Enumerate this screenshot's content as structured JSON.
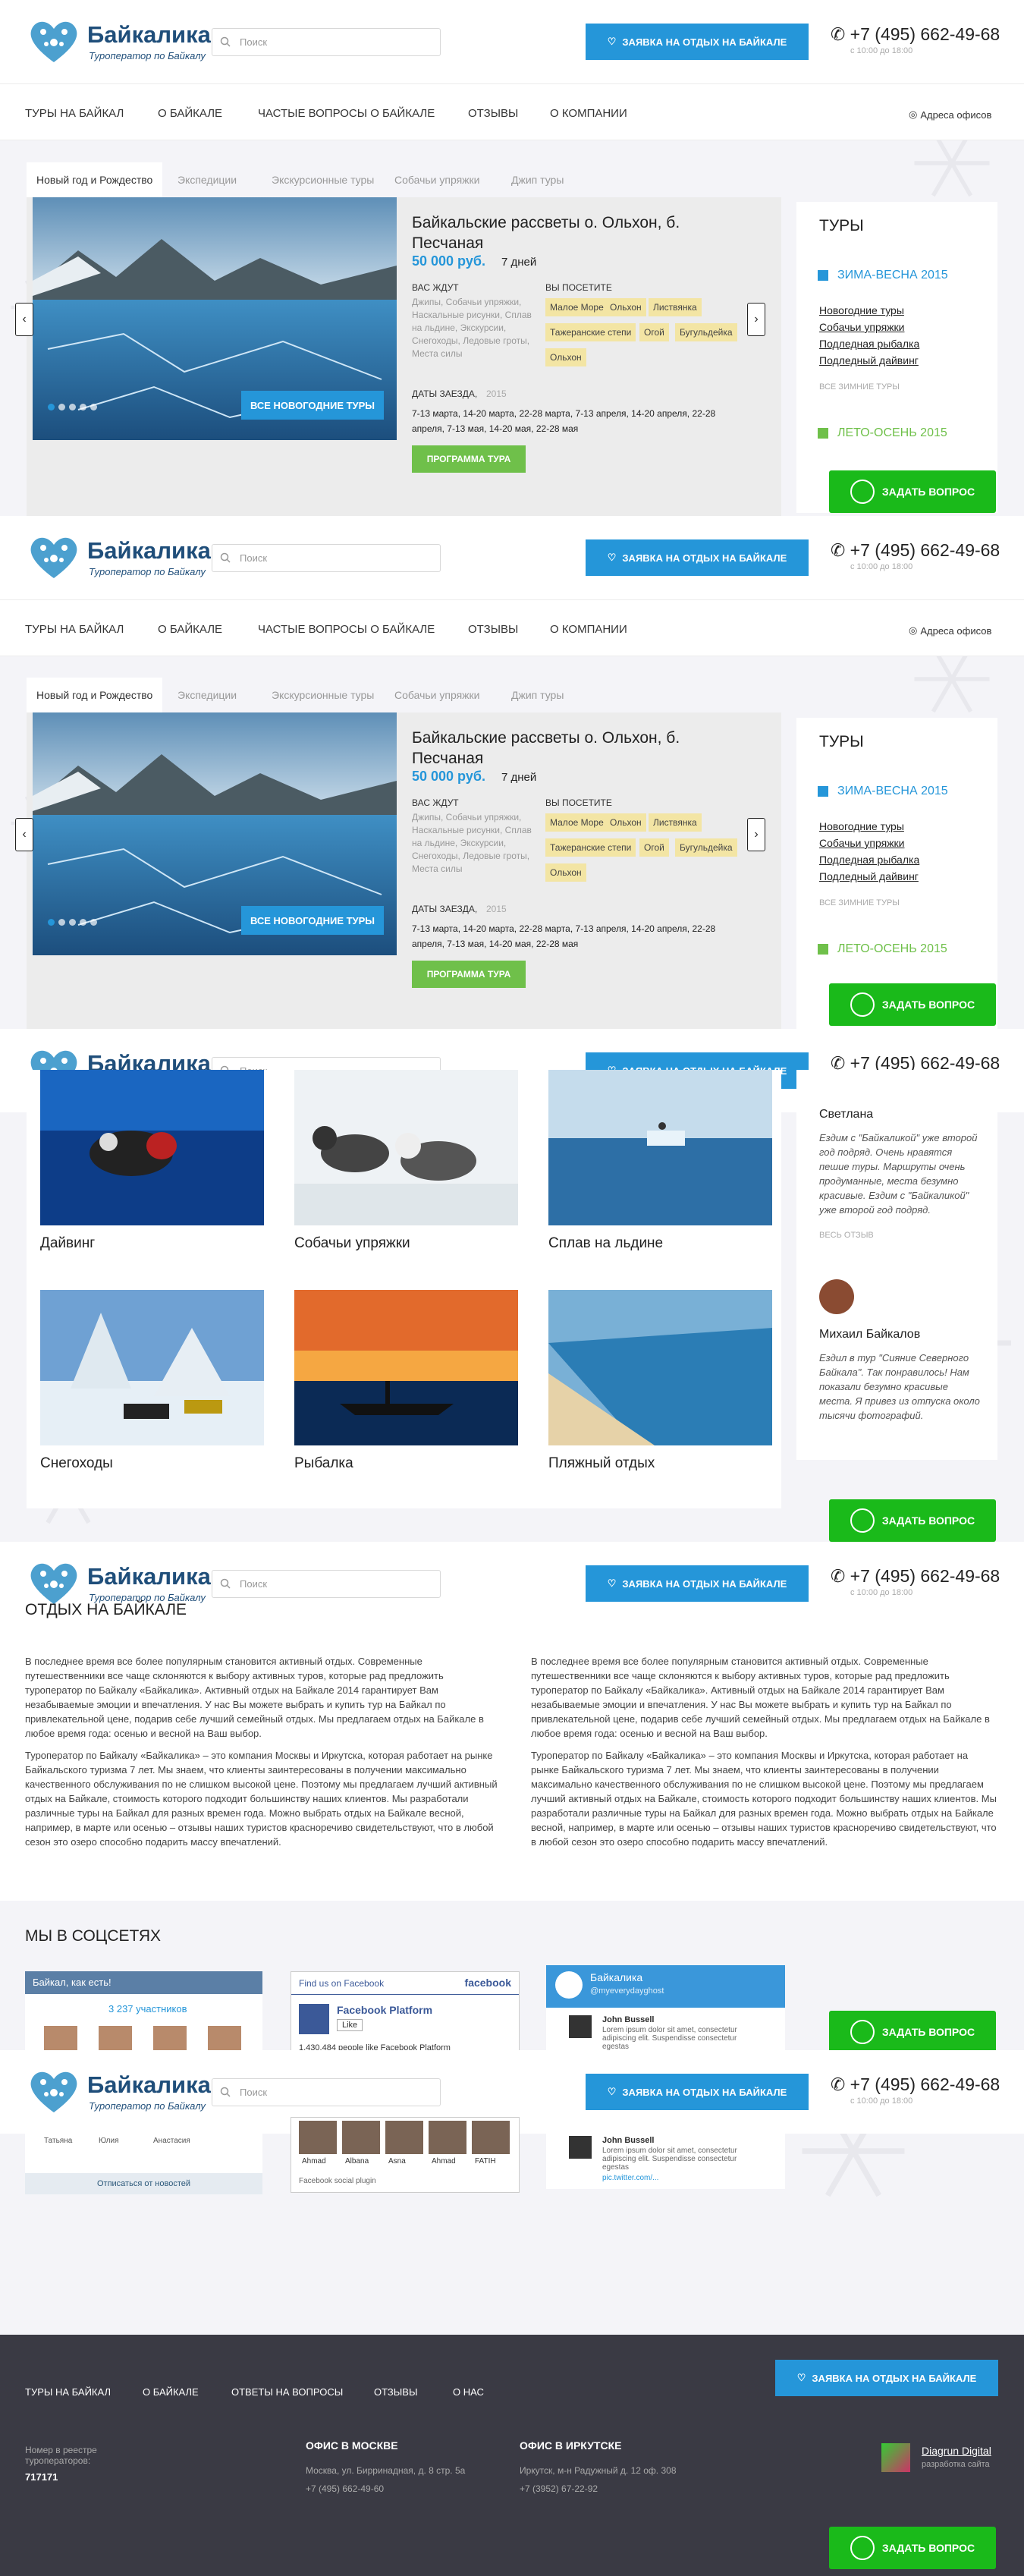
{
  "header": {
    "logo_name": "Байкалика",
    "logo_sub": "Туроператор по Байкалу",
    "search_placeholder": "Поиск",
    "request_button": "ЗАЯВКА НА ОТДЫХ НА БАЙКАЛЕ",
    "phone": "+7 (495) 662-49-68",
    "hours": "с 10:00 до 18:00"
  },
  "nav": {
    "items": [
      "ТУРЫ НА БАЙКАЛ",
      "О БАЙКАЛЕ",
      "ЧАСТЫЕ ВОПРОСЫ О БАЙКАЛЕ",
      "ОТЗЫВЫ",
      "О КОМПАНИИ"
    ],
    "offices": "Адреса офисов"
  },
  "tabs": [
    "Новый год и Рождество",
    "Экспедиции",
    "Экскурсионные туры",
    "Собачьи упряжки",
    "Джип туры"
  ],
  "tour": {
    "slide_button": "ВСЕ НОВОГОДНИЕ ТУРЫ",
    "title": "Байкальские рассветы о. Ольхон, б. Песчаная",
    "price": "50 000 руб.",
    "days": "7 дней",
    "await_label": "ВАС ЖДУТ",
    "await_text": "Джипы, Собачьи упряжки, Наскальные рисунки, Сплав на льдине, Экскурсии, Снегоходы, Ледовые гроты, Места силы",
    "visit_label": "ВЫ ПОСЕТИТЕ",
    "visit_tags": [
      "Малое Море",
      "Ольхон",
      "Листвянка",
      "Тажеранские степи",
      "Огой",
      "Бугульдейка",
      "Ольхон"
    ],
    "dates_label": "ДАТЫ ЗАЕЗДА,",
    "dates_year": "2015",
    "dates": "7-13 марта, 14-20 марта, 22-28 марта, 7-13 апреля, 14-20 апреля, 22-28 апреля, 7-13 мая, 14-20 мая, 22-28 мая",
    "program_button": "ПРОГРАММА ТУРА"
  },
  "sidebar": {
    "title": "ТУРЫ",
    "winter": "ЗИМА-ВЕСНА 2015",
    "winter_links": [
      "Новогодние туры",
      "Собачьи упряжки",
      "Подледная рыбалка",
      "Подледный дайвинг"
    ],
    "winter_all": "ВСЕ ЗИМНИЕ ТУРЫ",
    "summer": "ЛЕТО-ОСЕНЬ 2015"
  },
  "chat_button": "ЗАДАТЬ ВОПРОС",
  "activities": [
    "Дайвинг",
    "Собачьи упряжки",
    "Сплав на льдине",
    "Снегоходы",
    "Рыбалка",
    "Пляжный отдых"
  ],
  "reviews": {
    "first_name": "Светлана",
    "first_text": "Ездим с \"Байкаликой\" уже второй год подряд. Очень нравятся пешие туры. Маршруты очень продуманные, места безумно красивые. Ездим с \"Байкаликой\" уже второй год подряд.",
    "all_reviews": "ВЕСЬ ОТЗЫВ",
    "second_name": "Михаил Байкалов",
    "second_text": "Ездил в тур \"Сияние Северного Байкала\". Так понравилось! Нам показали безумно красивые места. Я привез из отпуска около тысячи фотографий."
  },
  "about": {
    "title": "ОТДЫХ НА БАЙКАЛЕ",
    "p1": "В последнее время все более популярным становится активный отдых. Современные путешественники все чаще склоняются к выбору активных туров, которые рад предложить туроператор по Байкалу «Байкалика». Активный отдых на Байкале 2014 гарантирует Вам незабываемые эмоции и впечатления. У нас Вы можете выбрать и купить тур на Байкал по привлекательной цене, подарив себе лучший семейный отдых. Мы предлагаем отдых на Байкале в любое время года: осенью и весной на Ваш выбор.",
    "p2": "Туроператор по Байкалу «Байкалика» – это компания Москвы и Иркутска, которая работает на рынке Байкальского туризма 7 лет. Мы знаем, что клиенты заинтересованы в получении максимально качественного обслуживания по не слишком высокой цене. Поэтому мы предлагаем лучший активный отдых на Байкале, стоимость которого подходит большинству наших клиентов. Мы разработали различные туры на Байкал для разных времен года. Можно выбрать отдых на Байкале весной, например, в марте или осенью – отзывы наших туристов красноречиво свидетельствуют, что в любой сезон это озеро способно подарить массу впечатлений."
  },
  "social": {
    "title": "МЫ В СОЦСЕТЯХ",
    "vk_title": "Байкал, как есть!",
    "vk_members": "3 237 участников",
    "vk_names": [
      "Татьяна",
      "Юлия",
      "Анастасия"
    ],
    "vk_unsub": "Отписаться от новостей",
    "fb_find": "Find us on Facebook",
    "fb_logo": "facebook",
    "fb_page": "Facebook Platform",
    "fb_like": "Like",
    "fb_people": "1,430,484 people like Facebook Platform",
    "fb_names": [
      "Ahmad",
      "Albana",
      "Asna",
      "Ahmad",
      "FATIH"
    ],
    "fb_plugin": "Facebook social plugin",
    "tw_name": "Байкалика",
    "tw_handle": "@myeverydayghost",
    "tw_user": "John Bussell",
    "tw_text": "Lorem ipsum dolor sit amet, consectetur adipiscing elit. Suspendisse consectetur egestas",
    "tw_link": "pic.twitter.com/..."
  },
  "footer": {
    "nav": [
      "ТУРЫ НА БАЙКАЛ",
      "О БАЙКАЛЕ",
      "ОТВЕТЫ НА ВОПРОСЫ",
      "ОТЗЫВЫ",
      "О НАС"
    ],
    "request_button": "ЗАЯВКА НА ОТДЫХ НА БАЙКАЛЕ",
    "registry_label": "Номер в реестре туроператоров:",
    "registry_number": "717171",
    "moscow_title": "ОФИС В МОСКВЕ",
    "moscow_address": "Москва, ул. Бирринадная, д. 8 стр. 5а",
    "moscow_phone": "+7 (495) 662-49-60",
    "irkutsk_title": "ОФИС В ИРКУТСКЕ",
    "irkutsk_address": "Иркутск, м-н Радужный д. 12 оф. 308",
    "irkutsk_phone": "+7 (3952) 67-22-92",
    "dev_name": "Diagrun Digital",
    "dev_sub": "разработка сайта"
  },
  "colors": {
    "accent_blue": "#2596d9",
    "green": "#6fc04a",
    "chat_green": "#1aba1a",
    "footer_bg": "#3a3a44",
    "tag_yellow": "#f3e5a4"
  }
}
